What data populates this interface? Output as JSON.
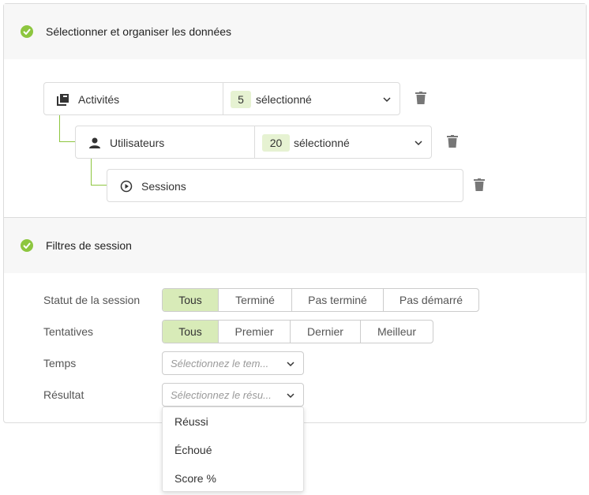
{
  "section1": {
    "title": "Sélectionner et organiser les données"
  },
  "hierarchy": [
    {
      "label": "Activités",
      "icon": "activities-icon",
      "count": "5",
      "selected_text": "sélectionné"
    },
    {
      "label": "Utilisateurs",
      "icon": "user-icon",
      "count": "20",
      "selected_text": "sélectionné"
    },
    {
      "label": "Sessions",
      "icon": "play-circle-icon"
    }
  ],
  "section2": {
    "title": "Filtres de session"
  },
  "filters": {
    "status": {
      "label": "Statut de la session",
      "options": [
        "Tous",
        "Terminé",
        "Pas terminé",
        "Pas démarré"
      ],
      "selected": "Tous"
    },
    "attempts": {
      "label": "Tentatives",
      "options": [
        "Tous",
        "Premier",
        "Dernier",
        "Meilleur"
      ],
      "selected": "Tous"
    },
    "time": {
      "label": "Temps",
      "placeholder": "Sélectionnez le tem..."
    },
    "result": {
      "label": "Résultat",
      "placeholder": "Sélectionnez le résu..."
    }
  },
  "result_dropdown": {
    "options": [
      "Réussi",
      "Échoué",
      "Score %"
    ]
  },
  "colors": {
    "accent": "#8dc63f",
    "active_segment": "#d8ebb8",
    "count_badge": "#e6f2d2"
  }
}
